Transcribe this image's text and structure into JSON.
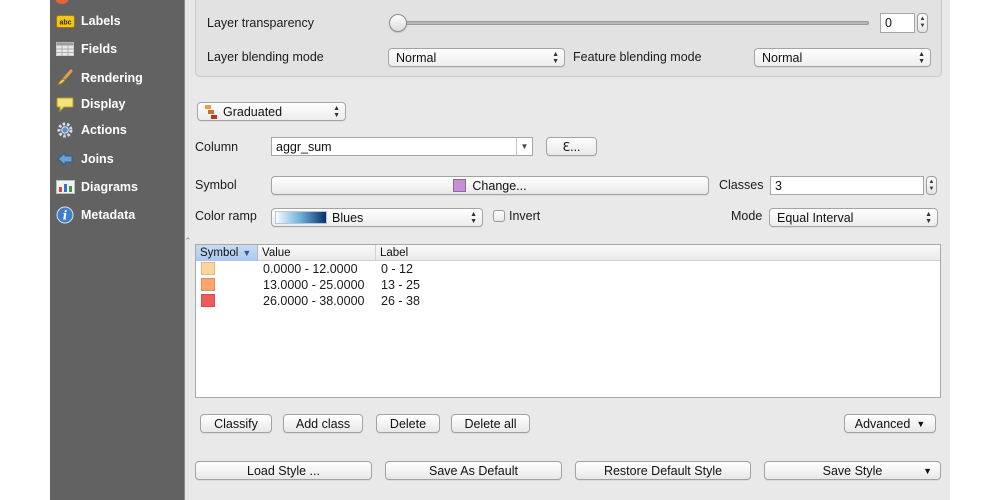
{
  "sidebar": {
    "items": [
      {
        "label": "Labels",
        "icon": "abc-labels-icon"
      },
      {
        "label": "Fields",
        "icon": "table-fields-icon"
      },
      {
        "label": "Rendering",
        "icon": "paintbrush-icon"
      },
      {
        "label": "Display",
        "icon": "speech-bubble-icon"
      },
      {
        "label": "Actions",
        "icon": "gear-actions-icon"
      },
      {
        "label": "Joins",
        "icon": "join-arrow-icon"
      },
      {
        "label": "Diagrams",
        "icon": "chart-diagram-icon"
      },
      {
        "label": "Metadata",
        "icon": "info-icon"
      }
    ]
  },
  "layer_rendering": {
    "transparency_label": "Layer transparency",
    "transparency_value": "0",
    "transparency_fraction": 0,
    "blending_label": "Layer blending mode",
    "blending_value": "Normal",
    "feature_blending_label": "Feature blending mode",
    "feature_blending_value": "Normal"
  },
  "renderer": {
    "type": "Graduated",
    "column_label": "Column",
    "column_value": "aggr_sum",
    "expression_button": "ℇ...",
    "symbol_label": "Symbol",
    "symbol_button": "Change...",
    "symbol_color": "#c88fd6",
    "classes_label": "Classes",
    "classes_value": "3",
    "color_ramp_label": "Color ramp",
    "color_ramp_value": "Blues",
    "invert_label": "Invert",
    "invert_checked": false,
    "mode_label": "Mode",
    "mode_value": "Equal Interval"
  },
  "table": {
    "headers": {
      "symbol": "Symbol",
      "value": "Value",
      "label": "Label"
    },
    "rows": [
      {
        "color": "#fdd49e",
        "value": "0.0000 - 12.0000",
        "label": "0 - 12"
      },
      {
        "color": "#fca36e",
        "value": "13.0000 - 25.0000",
        "label": "13 - 25"
      },
      {
        "color": "#ef5a5a",
        "value": "26.0000 - 38.0000",
        "label": "26 - 38"
      }
    ]
  },
  "actions": {
    "classify": "Classify",
    "add_class": "Add class",
    "delete": "Delete",
    "delete_all": "Delete all",
    "advanced": "Advanced"
  },
  "footer": {
    "load_style": "Load Style ...",
    "save_as_default": "Save As Default",
    "restore_default": "Restore Default Style",
    "save_style": "Save Style"
  }
}
